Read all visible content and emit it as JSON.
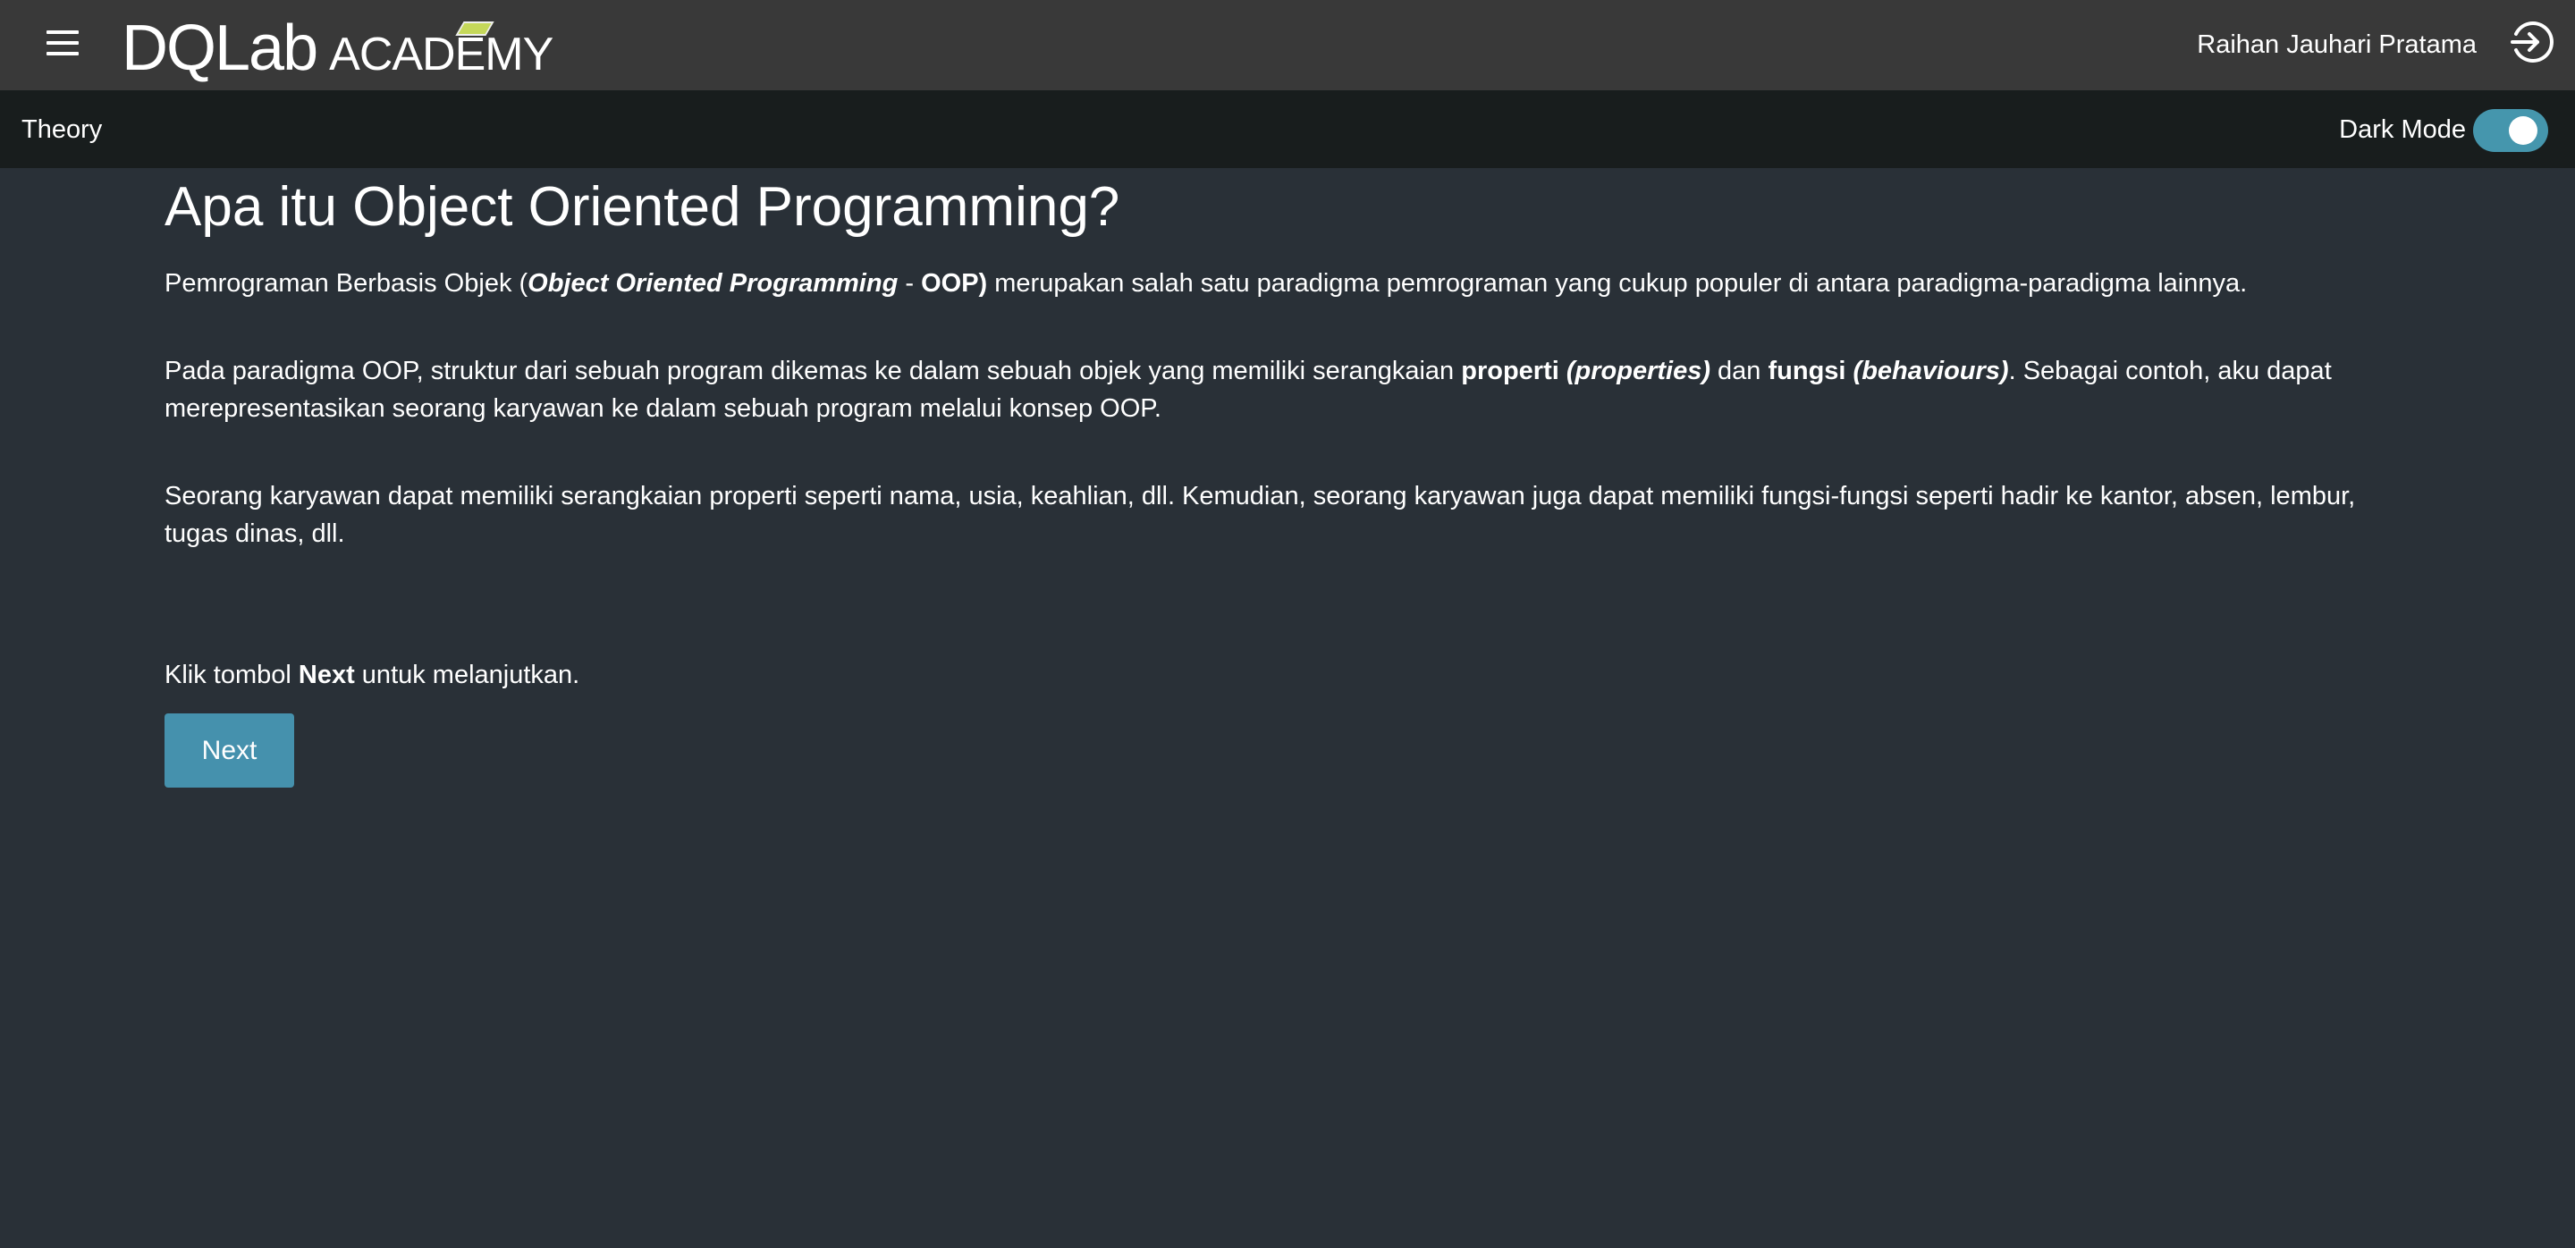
{
  "header": {
    "logo_text": "DQLab",
    "logo_subtext": "ACADEMY",
    "user_name": "Raihan Jauhari Pratama",
    "icons": {
      "menu": "hamburger-icon",
      "logout": "sign-in-arrow-circle-icon"
    }
  },
  "subbar": {
    "section": "Theory",
    "dark_mode_label": "Dark Mode",
    "dark_mode_on": true
  },
  "content": {
    "title": "Apa itu Object Oriented Programming?",
    "p1": {
      "a": "Pemrograman Berbasis Objek (",
      "b": "Object Oriented Programming",
      "c": " - ",
      "d": "OOP)",
      "e": " merupakan salah satu paradigma pemrograman yang cukup populer di antara paradigma-paradigma lainnya."
    },
    "p2": {
      "a": "Pada paradigma OOP, struktur dari sebuah program dikemas ke dalam sebuah objek yang memiliki serangkaian ",
      "b": "properti",
      "c": " (properties)",
      "d": " dan ",
      "e": "fungsi",
      "f": " (behaviours)",
      "g": ". Sebagai contoh, aku dapat merepresentasikan seorang karyawan ke dalam sebuah program melalui konsep OOP."
    },
    "p3": "Seorang karyawan dapat memiliki serangkaian properti seperti nama, usia, keahlian, dll. Kemudian, seorang karyawan juga dapat memiliki fungsi-fungsi seperti hadir ke kantor, absen, lembur, tugas dinas, dll.",
    "klik": {
      "a": "Klik tombol ",
      "b": "Next",
      "c": " untuk melanjutkan."
    },
    "next_label": "Next"
  },
  "colors": {
    "header": "#393939",
    "subbar": "#181d1d",
    "background": "#293037",
    "accent": "#4591ad"
  }
}
